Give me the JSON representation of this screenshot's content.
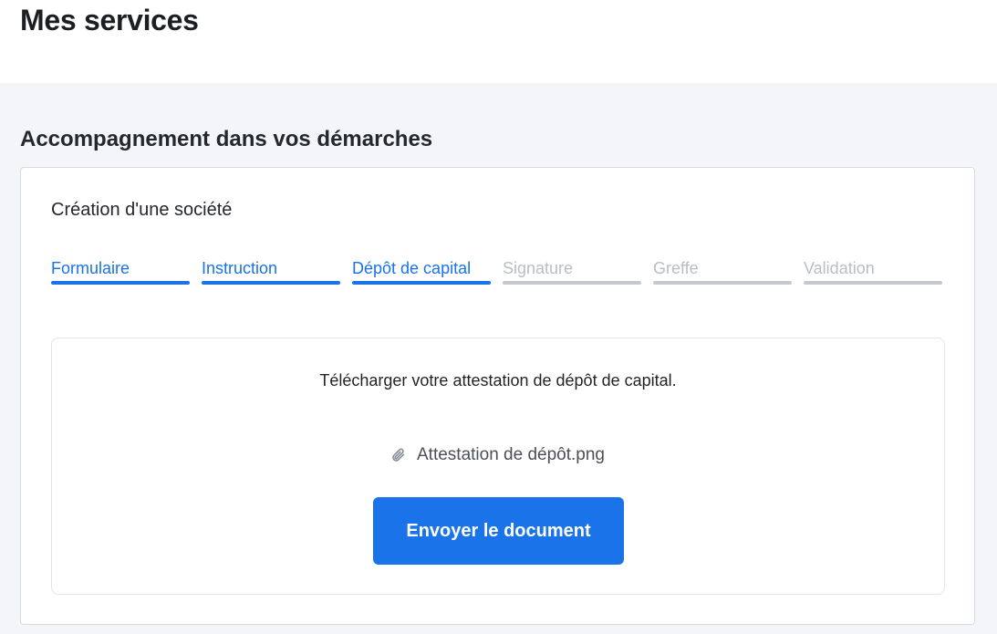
{
  "header": {
    "title": "Mes services"
  },
  "section": {
    "title": "Accompagnement dans vos démarches"
  },
  "card": {
    "title": "Création d'une société",
    "steps": [
      {
        "label": "Formulaire",
        "status": "done"
      },
      {
        "label": "Instruction",
        "status": "done"
      },
      {
        "label": "Dépôt de capital",
        "status": "current"
      },
      {
        "label": "Signature",
        "status": "todo"
      },
      {
        "label": "Greffe",
        "status": "todo"
      },
      {
        "label": "Validation",
        "status": "todo"
      }
    ]
  },
  "upload": {
    "instruction": "Télécharger votre attestation de dépôt de capital.",
    "file_icon": "paperclip-icon",
    "file_name": "Attestation de dépôt.png",
    "send_label": "Envoyer le document"
  },
  "colors": {
    "accent": "#1a73e8",
    "inactive_step": "#c3c9d1",
    "background": "#f4f5f8"
  }
}
